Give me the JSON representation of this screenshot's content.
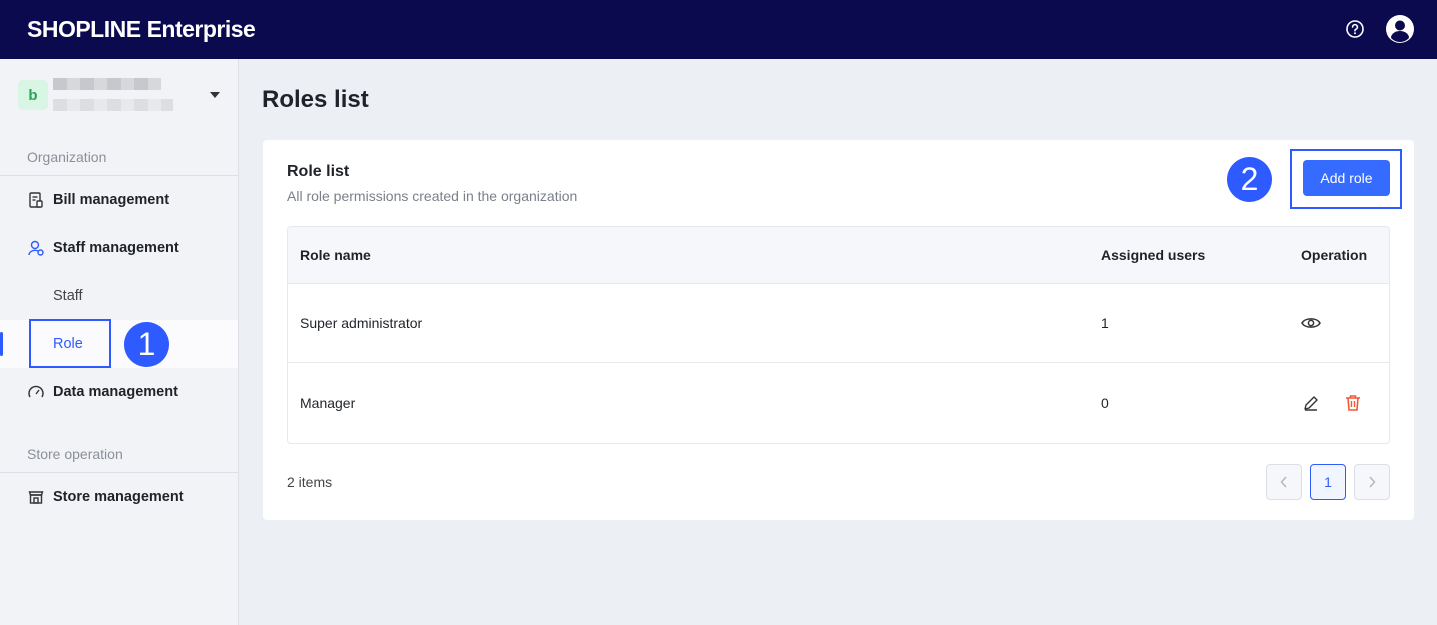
{
  "header": {
    "logo_brand": "SHOPLINE",
    "logo_suffix": "Enterprise",
    "help_icon": "help-circle-icon",
    "user_icon": "user-avatar-icon"
  },
  "sidebar": {
    "org_initial": "b",
    "sections": [
      {
        "label": "Organization"
      },
      {
        "label": "Store operation"
      }
    ],
    "items": [
      {
        "label": "Bill management",
        "icon": "bill-icon"
      },
      {
        "label": "Staff management",
        "icon": "staff-icon"
      },
      {
        "label": "Staff"
      },
      {
        "label": "Role"
      },
      {
        "label": "Data management",
        "icon": "dashboard-gauge-icon"
      },
      {
        "label": "Store management",
        "icon": "store-icon"
      }
    ]
  },
  "callouts": {
    "step1": "1",
    "step2": "2"
  },
  "main": {
    "page_title": "Roles list",
    "card_title": "Role list",
    "card_subtitle": "All role permissions created in the organization",
    "add_button": "Add role",
    "table": {
      "headers": [
        "Role name",
        "Assigned users",
        "Operation"
      ],
      "rows": [
        {
          "name": "Super administrator",
          "users": "1",
          "operations": [
            "view"
          ]
        },
        {
          "name": "Manager",
          "users": "0",
          "operations": [
            "edit",
            "delete"
          ]
        }
      ]
    },
    "pagination": {
      "total_label": "2 items",
      "current_page": "1"
    }
  },
  "colors": {
    "topbar": "#0c0a4e",
    "accent": "#2d5bff",
    "delete": "#f0583a"
  }
}
